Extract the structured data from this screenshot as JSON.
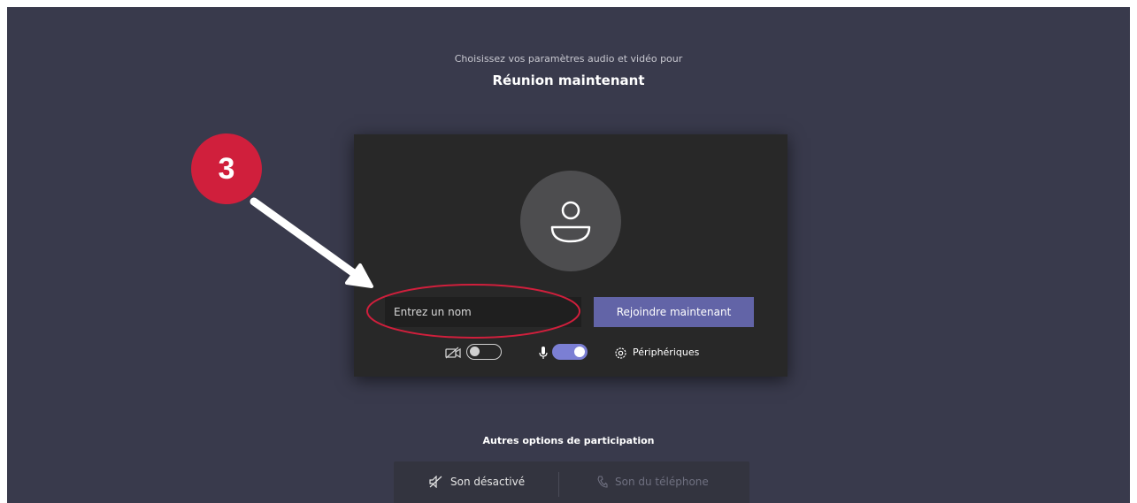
{
  "header": {
    "intro": "Choisissez vos paramètres audio et vidéo pour",
    "meeting_title": "Réunion maintenant"
  },
  "preview": {
    "avatar_icon": "person-icon",
    "name_placeholder": "Entrez un nom",
    "name_value": "",
    "join_label": "Rejoindre maintenant",
    "camera": {
      "icon": "camera-off-icon",
      "state": "off"
    },
    "mic": {
      "icon": "microphone-icon",
      "state": "on"
    },
    "devices": {
      "icon": "gear-icon",
      "label": "Périphériques"
    }
  },
  "other_options": {
    "title": "Autres options de participation",
    "audio_off": {
      "icon": "speaker-off-icon",
      "label": "Son désactivé"
    },
    "phone_audio": {
      "icon": "phone-icon",
      "label": "Son du téléphone"
    }
  },
  "annotation": {
    "step_number": "3",
    "badge_color": "#d01f3c",
    "highlight_color": "#d01f3c"
  },
  "colors": {
    "background": "#393a4c",
    "panel": "#282828",
    "accent": "#6264a7"
  }
}
